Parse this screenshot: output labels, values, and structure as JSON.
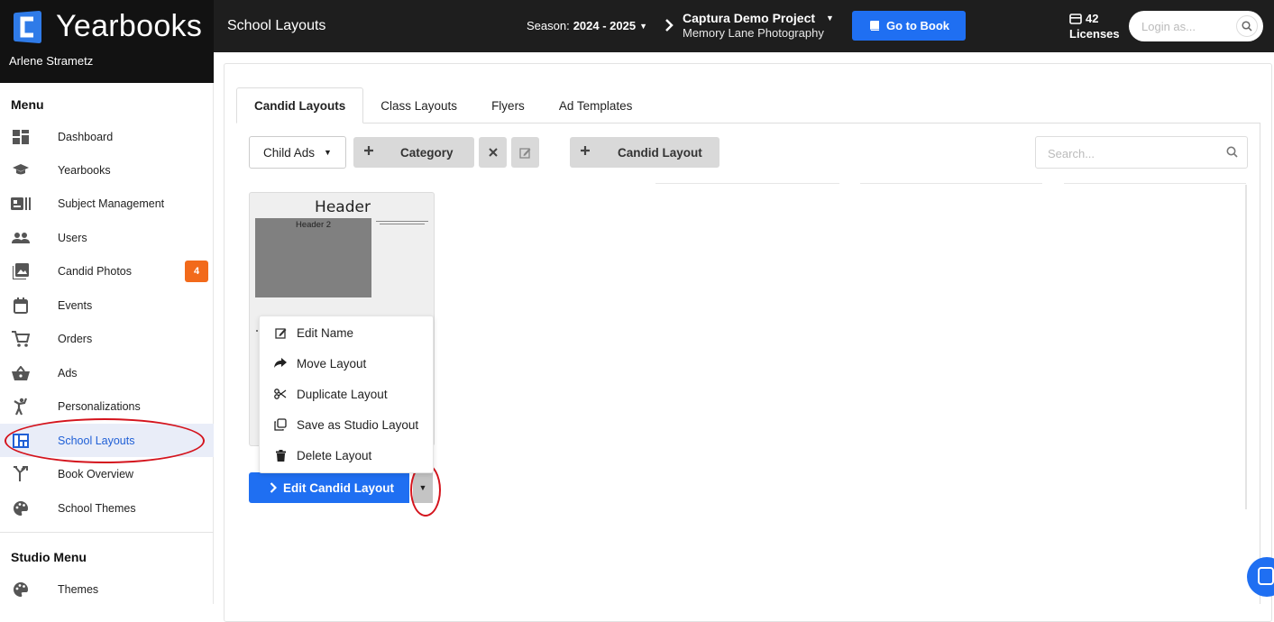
{
  "brand": {
    "name": "Yearbooks",
    "user": "Arlene Strametz"
  },
  "header": {
    "page_title": "School Layouts",
    "season_label": "Season:",
    "season_value": "2024 - 2025",
    "project_name": "Captura Demo Project",
    "project_sub": "Memory Lane Photography",
    "goto_label": "Go to Book",
    "licenses_count": "42",
    "licenses_label": "Licenses",
    "login_placeholder": "Login as..."
  },
  "sidebar": {
    "menu_heading": "Menu",
    "items": [
      {
        "label": "Dashboard",
        "icon": "dashboard-icon"
      },
      {
        "label": "Yearbooks",
        "icon": "graduation-cap-icon"
      },
      {
        "label": "Subject Management",
        "icon": "id-card-icon"
      },
      {
        "label": "Users",
        "icon": "users-icon"
      },
      {
        "label": "Candid Photos",
        "icon": "photo-icon",
        "badge": "4"
      },
      {
        "label": "Events",
        "icon": "calendar-icon"
      },
      {
        "label": "Orders",
        "icon": "cart-icon"
      },
      {
        "label": "Ads",
        "icon": "basket-icon"
      },
      {
        "label": "Personalizations",
        "icon": "person-pose-icon"
      },
      {
        "label": "School Layouts",
        "icon": "layout-icon",
        "active": true
      },
      {
        "label": "Book Overview",
        "icon": "fork-icon"
      },
      {
        "label": "School Themes",
        "icon": "palette-icon"
      }
    ],
    "studio_heading": "Studio Menu",
    "studio_items": [
      {
        "label": "Themes",
        "icon": "palette-icon"
      }
    ]
  },
  "tabs": [
    "Candid Layouts",
    "Class Layouts",
    "Flyers",
    "Ad Templates"
  ],
  "active_tab": "Candid Layouts",
  "toolbar": {
    "child_ads": "Child Ads",
    "category": "Category",
    "candid_layout": "Candid Layout",
    "search_placeholder": "Search..."
  },
  "layout_card": {
    "title": "Header",
    "photo_label": "Header 2"
  },
  "context_menu": {
    "items": [
      {
        "label": "Edit Name",
        "icon": "edit-icon"
      },
      {
        "label": "Move Layout",
        "icon": "share-arrow-icon"
      },
      {
        "label": "Duplicate Layout",
        "icon": "scissors-icon"
      },
      {
        "label": "Save as Studio Layout",
        "icon": "copy-icon"
      },
      {
        "label": "Delete Layout",
        "icon": "trash-icon"
      }
    ]
  },
  "edit_button": "Edit Candid Layout",
  "colors": {
    "accent": "#1f6ff2",
    "badge": "#f26a1b",
    "annotation": "#d4141d",
    "topbar": "#1e1e1e"
  }
}
